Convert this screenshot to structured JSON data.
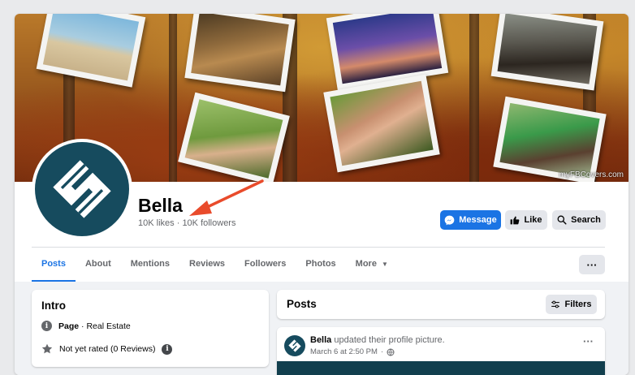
{
  "cover": {
    "watermark": "myFBCovers.com"
  },
  "profile": {
    "name": "Bella",
    "likes": "10K likes",
    "separator": "·",
    "followers": "10K followers"
  },
  "actions": {
    "message_label": "Message",
    "like_label": "Like",
    "search_label": "Search"
  },
  "tabs": [
    {
      "label": "Posts",
      "active": true
    },
    {
      "label": "About"
    },
    {
      "label": "Mentions"
    },
    {
      "label": "Reviews"
    },
    {
      "label": "Followers"
    },
    {
      "label": "Photos"
    },
    {
      "label": "More"
    }
  ],
  "more_dots": "···",
  "intro": {
    "title": "Intro",
    "category_label": "Page",
    "category_value": " · Real Estate",
    "rating_text": "Not yet rated (0 Reviews)"
  },
  "posts": {
    "title": "Posts",
    "filters_label": "Filters",
    "item": {
      "author": "Bella",
      "action": " updated their profile picture.",
      "timestamp": "March 6 at 2:50 PM",
      "separator": "·",
      "more": "···"
    }
  },
  "colors": {
    "brand_blue": "#1b74e4",
    "logo_teal": "#164b5e",
    "arrow_red": "#e94b2b"
  }
}
